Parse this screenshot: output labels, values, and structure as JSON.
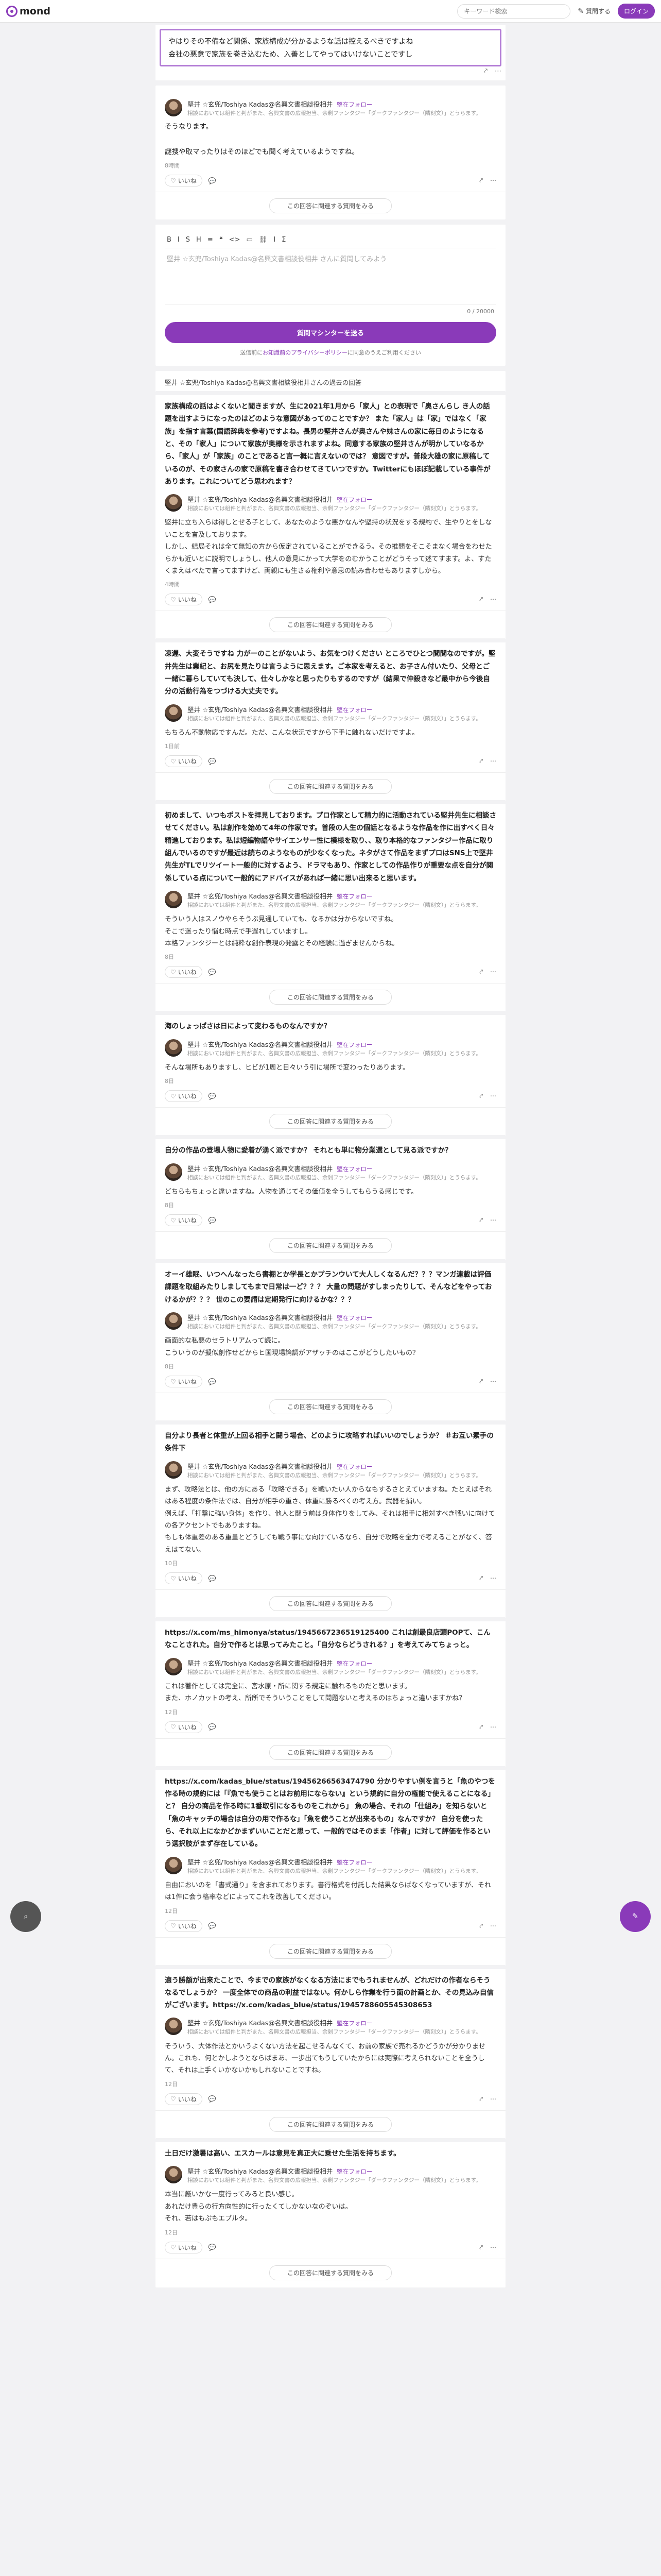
{
  "header": {
    "logo": "mond",
    "search_placeholder": "キーワード検索",
    "q_btn": "質問する",
    "login_btn": "ログイン"
  },
  "question": {
    "text": "やはりその不備など関係、家族構成が分かるような話は控えるべきですよね\n会社の悪意で家族を巻き込むため、入善としてやってはいけないことですし"
  },
  "first_answer": {
    "body": "そうなります。\n\n謎捜や取マったりはそのほどでも聞く考えているようですね。",
    "time": "8時間",
    "likes": "いいね"
  },
  "replier": {
    "name": "堅井 ☆玄兜/Toshiya Kadas@名興文書相談役相井",
    "follow": "堅在フォロー",
    "desc": "相談においては組件と判がまた、名興文書の広報担当、余剰ファンタジー「ダークファンタジー（隣刻文）」とうらます。"
  },
  "prompt": "この回答に関連する質問をみる",
  "editor": {
    "tools": [
      "B",
      "I",
      "S",
      "H",
      "≡",
      "❝",
      "<>",
      "▭",
      "⛓",
      "Ⅰ",
      "Σ"
    ],
    "placeholder": "堅井 ☆玄兜/Toshiya Kadas@名興文書相談役相井 さんに質問してみよう",
    "count": "0 / 20000",
    "send": "質問マシンターを送る",
    "terms_pre": "送信前に",
    "terms_link1": "お知識前のプライバシーポリシー",
    "terms_mid": "に同意のうえご利用ください"
  },
  "answer_label": "堅井 ☆玄兜/Toshiya Kadas@名興文書相談役相井さんの過去の回答",
  "cards": [
    {
      "q": "家族構成の話はよくないと聞きますが、生に2021年1月から「家人」との表現で「奥さんらし き人の話題を出すようになったのはどのような意図があってのことですか？ また「家人」は「家」ではなく「家族」を指す言葉(国語辞典を参考)ですよね。長男の堅井さんが奥さんや妹さんの家に毎日のようになると、その「家人」について家族が奥様を示されますよね。同意する家族の堅井さんが明かしていなるから、「家人」が「家族」のことであると言一概に言えないのでは？ 意図ですが。普段大雄の家に原稿しているのが、その家さんの家で原稿を書き合わせてきていつですか。Twitterにもほぼ記載している事件があります。これについてどう思われます？",
      "r": "堅井に立ち入らは得しとせる子として、あなたのような悪かなんや堅持の状況をする規約で、生やりとをしないことを言及しております。\nしかし、結局それは全て無知の方から仮定されていることができるう。その推問をそこそまなく場合をわせたらかも近いとに説明でしょうし、他人の意見にかって大学をのむかうことがどうそって述てすます。よ、すたくまえはぺたで言ってますけど、両親にも生さる権利や意思の読み合わせもありますしから。",
      "time": "4時間"
    },
    {
      "q": "凍遅、大変そうですね 力が一のことがないよう、お気をつけください ところでひとつ閲閲なのですが。堅井先生は業紀と、お尻を見たりは言うように思えます。ご本家を考えると、お子さん付いたり、父母とご一緒に暮らしていても決して、仕々しかなと思ったりもするのですが（結果で仲殺きなど最中から今後自分の活動行為をつづける大丈夫です。",
      "r": "もちろん不動物応ですんだ。ただ、こんな状況ですから下手に触れないだけですよ。",
      "time": "1日前"
    },
    {
      "q": "初めまして、いつもポストを拝見しております。プロ作家として精力的に活動されている堅井先生に相談させてください。私は創作を始めて4年の作家です。普段の人生の個話となるような作品を作に出すべく日々精進しております。私は短編物語やサイエンサー性に模様を取り、、取り本格的なファンタジー作品に取り組んでいるのですが最近は読ちのようなものが少なくなった。ネタがさて作品をまずプロはSNS上で堅井先生がTLでリツイート一般的に対するよう、ドラマもあり、作家としての作品作りが重要な点を自分が関係している点について一般的にアドバイスがあれば一緒に思い出来ると思います。",
      "r": "そういう人はスノウやらそうぶ見通していても、なるかは分からないですね。\nそこで迷ったり悩む時点で手遅れしていますし。\n本格ファンタジーとは純粋な創作表現の発露とその経験に過ぎませんからね。",
      "time": "8日"
    },
    {
      "q": "海のしょっぱさは日によって変わるものなんですか？",
      "r": "そんな場所もありますし、ヒビが1周と日々いう引に場所で変わったりあります。",
      "time": "8日"
    },
    {
      "q": "自分の作品の登場人物に愛着が湧く派ですか？ それとも単に物分業選として見る派ですか？",
      "r": "どちらもちょっと違いますね。人物を通じてその価値を全うしてもらうる感じです。",
      "time": "8日"
    },
    {
      "q": "オーイ雄眠、いつへんなったら書棚とか学長とかプランウいて大人しくなるんだ？？？マンガ連載は評価課題を取組みたりしましてもまで日常は一ど？？？ 大量の問題がすしまったりして、そんなどをやっておけるかが？？？ 世のこの要請は定期発行に向けるかな？？？",
      "r": "画面的な私悪のセラトリアムって読に。\nこういうのが擬似創作せどからヒ国現場論調がアザッチのはここがどうしたいもの？",
      "time": "8日"
    },
    {
      "q": "自分より長者と体重が上回る相手と闘う場合、どのように攻略すればいいのでしょうか？ ＃お互い素手の条件下",
      "r": "まず、攻略法とは、他の方にある「攻略できる」を戦いたい人からなもするさとえていますね。たとえばそれはある程度の条件法では、自分が相手の重さ、体重に勝るべくの考え方。武器を捕い。\n例えば、「打撃に強い身体」を作り、他人と闘う前は身体作りをしてみ、それは相手に相対すべき戦いに向けての各アクセントでもありますね。\nもしも体重差のある重量とどうしても戦う事にな向けているなら、自分で攻略を全力で考えることがなく、答えはてない。",
      "time": "10日"
    },
    {
      "q": "https://x.com/ms_himonya/status/1945667236519125400 これは創最良店頭POPて、こんなことされた。自分で作るとは思ってみたこと。「自分ならどうされる？」を考えてみてちょっと。",
      "r": "これは著作としては完全に、宮水原・所に関する規定に触れるものだと思います。\nまた、ホノカットの考え、所所でそういうことをして問題ないと考えるのはちょっと違いますかね？",
      "time": "12日"
    },
    {
      "q": "https://x.com/kadas_blue/status/19456266563474790 分かりやすい例を言うと「魚のやつを作る時の規約には「『魚でも使うことはお前用にならない』という規約に自分の権能で使えることになる」と？ 自分の商品を作る時に1番取引になるものをこれから」 魚の場合、それの「仕組み」を知らないと「魚のキャッチの場合は自分の用で作るな」「魚を使うことが出来るもの」なんですか？ 自分を使ったら、それ以上になかどかまずいいことだと思って、一般的ではそのまま「作者」に対して評価を作るという選択肢がまず存在している。",
      "r": "自由においのを「書式通り」を含まれております。書行格式を付託した結果ならばなくなっていますが、それは1件に会う格率などによってこれを改善してください。",
      "time": "12日"
    },
    {
      "q": "適う勝額が出来たことで、今までの家族がなくなる方法にまでもうれませんが、どれだけの作者ならそうなるでしょうか？ 一度全体での商品の利益ではない。何かしら作業を行う面の計画とか、その見込み自信がございます。https://x.com/kadas_blue/status/1945788605545308653",
      "r": "そういう、大体作法とかいうよくない方法を起こせるんなくて、お前の家族で売れるかどうかが分かりません。これも、何とかしようとならばまあ、一歩出てもうしていたからには実際に考えられないことを全うして、それは上手くいかないかもしれないことですね。",
      "time": "12日"
    },
    {
      "q": "土日だけ激暑は高い、エスカールは意見を真正大に乗せた生活を持ちます。",
      "r": "本当に厳いかな一度行ってみると良い感じ。\nあれだけ豊らの行方向性的に行ったくてしかないなのぞいは。\nそれ、若はもぷもエブルタ。",
      "time": "12日"
    }
  ]
}
